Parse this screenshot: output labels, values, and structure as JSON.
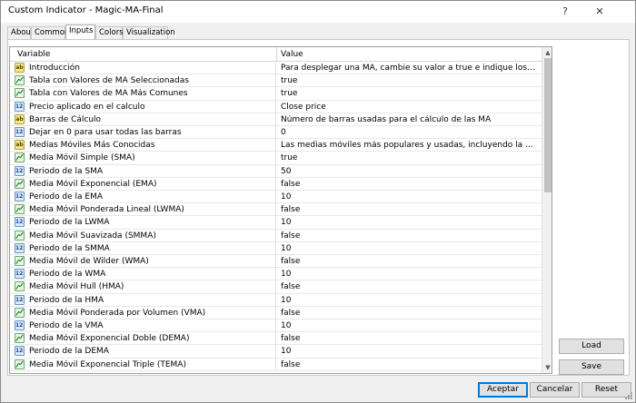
{
  "window": {
    "title": "Custom Indicator - Magic-MA-Final",
    "help_label": "?",
    "close_label": "✕"
  },
  "tabs": [
    "About",
    "Common",
    "Inputs",
    "Colors",
    "Visualization"
  ],
  "active_tab": "Inputs",
  "grid": {
    "col_variable": "Variable",
    "col_value": "Value",
    "rows": [
      {
        "type": "ab",
        "name": "Introducción",
        "value": "Para desplegar una MA, cambie su valor a true e indique los parámetros de su elec..."
      },
      {
        "type": "bool",
        "name": "Tabla con Valores de MA Seleccionadas",
        "value": "true"
      },
      {
        "type": "bool",
        "name": "Tabla con Valores de MA Más Comunes",
        "value": "true"
      },
      {
        "type": "num",
        "name": "Precio aplicado en el calculo",
        "value": "Close price"
      },
      {
        "type": "ab",
        "name": "Barras de Cálculo",
        "value": "Número de barras usadas para el cálculo de las MA"
      },
      {
        "type": "num",
        "name": "Dejar en 0 para usar todas las barras",
        "value": "0"
      },
      {
        "type": "ab",
        "name": "Medias Móviles Más Conocidas",
        "value": "Las medias móviles más populares y usadas, incluyendo la SMA,EMA,SMMA,DEM..."
      },
      {
        "type": "bool",
        "name": "Media Móvil Simple (SMA)",
        "value": "true"
      },
      {
        "type": "num",
        "name": "Periodo de la SMA",
        "value": "50"
      },
      {
        "type": "bool",
        "name": "Media Móvil Exponencial (EMA)",
        "value": "false"
      },
      {
        "type": "num",
        "name": "Periodo de la EMA",
        "value": "10"
      },
      {
        "type": "bool",
        "name": "Media Móvil Ponderada Lineal (LWMA)",
        "value": "false"
      },
      {
        "type": "num",
        "name": "Periodo de la LWMA",
        "value": "10"
      },
      {
        "type": "bool",
        "name": "Media Móvil Suavizada (SMMA)",
        "value": "false"
      },
      {
        "type": "num",
        "name": "Periodo de la SMMA",
        "value": "10"
      },
      {
        "type": "bool",
        "name": "Media Móvil de Wilder (WMA)",
        "value": "false"
      },
      {
        "type": "num",
        "name": "Periodo de la WMA",
        "value": "10"
      },
      {
        "type": "bool",
        "name": "Media Móvil Hull (HMA)",
        "value": "false"
      },
      {
        "type": "num",
        "name": "Periodo de la HMA",
        "value": "10"
      },
      {
        "type": "bool",
        "name": "Media Móvil Ponderada por Volumen (VMA)",
        "value": "false"
      },
      {
        "type": "num",
        "name": "Periodo de la VMA",
        "value": "10"
      },
      {
        "type": "bool",
        "name": "Media Móvil Exponencial Doble (DEMA)",
        "value": "false"
      },
      {
        "type": "num",
        "name": "Periodo de la DEMA",
        "value": "10"
      },
      {
        "type": "bool",
        "name": "Media Móvil Exponencial Triple (TEMA)",
        "value": "false"
      }
    ]
  },
  "icons": {
    "ab": "ab",
    "num": "123",
    "bool": "curve-icon"
  },
  "buttons": {
    "load": "Load",
    "save": "Save",
    "accept": "Aceptar",
    "cancel": "Cancelar",
    "reset": "Reset"
  }
}
